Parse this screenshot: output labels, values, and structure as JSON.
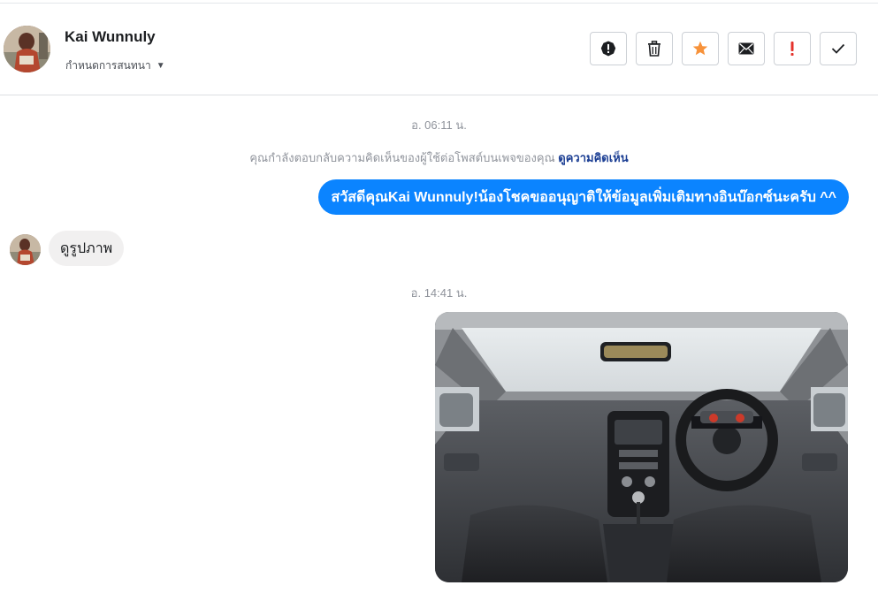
{
  "contact": {
    "name": "Kai Wunnuly",
    "setting_label": "กำหนดการสนทนา"
  },
  "toolbar": {
    "buttons": [
      {
        "name": "report-spam-button",
        "icon": "exclamation-circle-icon",
        "color": "#1c1e21"
      },
      {
        "name": "delete-button",
        "icon": "trash-icon",
        "color": "#1c1e21"
      },
      {
        "name": "star-button",
        "icon": "star-icon",
        "color": "#f7923a"
      },
      {
        "name": "mark-unread-button",
        "icon": "envelope-icon",
        "color": "#1c1e21"
      },
      {
        "name": "follow-up-button",
        "icon": "exclamation-mark-icon",
        "color": "#e4322b"
      },
      {
        "name": "mark-done-button",
        "icon": "check-icon",
        "color": "#1c1e21"
      }
    ]
  },
  "conversation": {
    "timestamp_1": "อ. 06:11 น.",
    "notice_text": "คุณกำลังตอบกลับความคิดเห็นของผู้ใช้ต่อโพสต์บนเพจของคุณ ",
    "notice_link": "ดูความคิดเห็น",
    "outgoing_message": "สวัสดีคุณKai Wunnuly!น้องโชคขออนุญาติให้ข้อมูลเพิ่มเติมทางอินบ๊อกซ์นะครับ ^^",
    "incoming_message": "ดูรูปภาพ",
    "timestamp_2": "อ. 14:41 น."
  },
  "colors": {
    "accent": "#0b84ff",
    "incoming_bubble": "#f1f0f0",
    "link": "#1c3f94"
  }
}
